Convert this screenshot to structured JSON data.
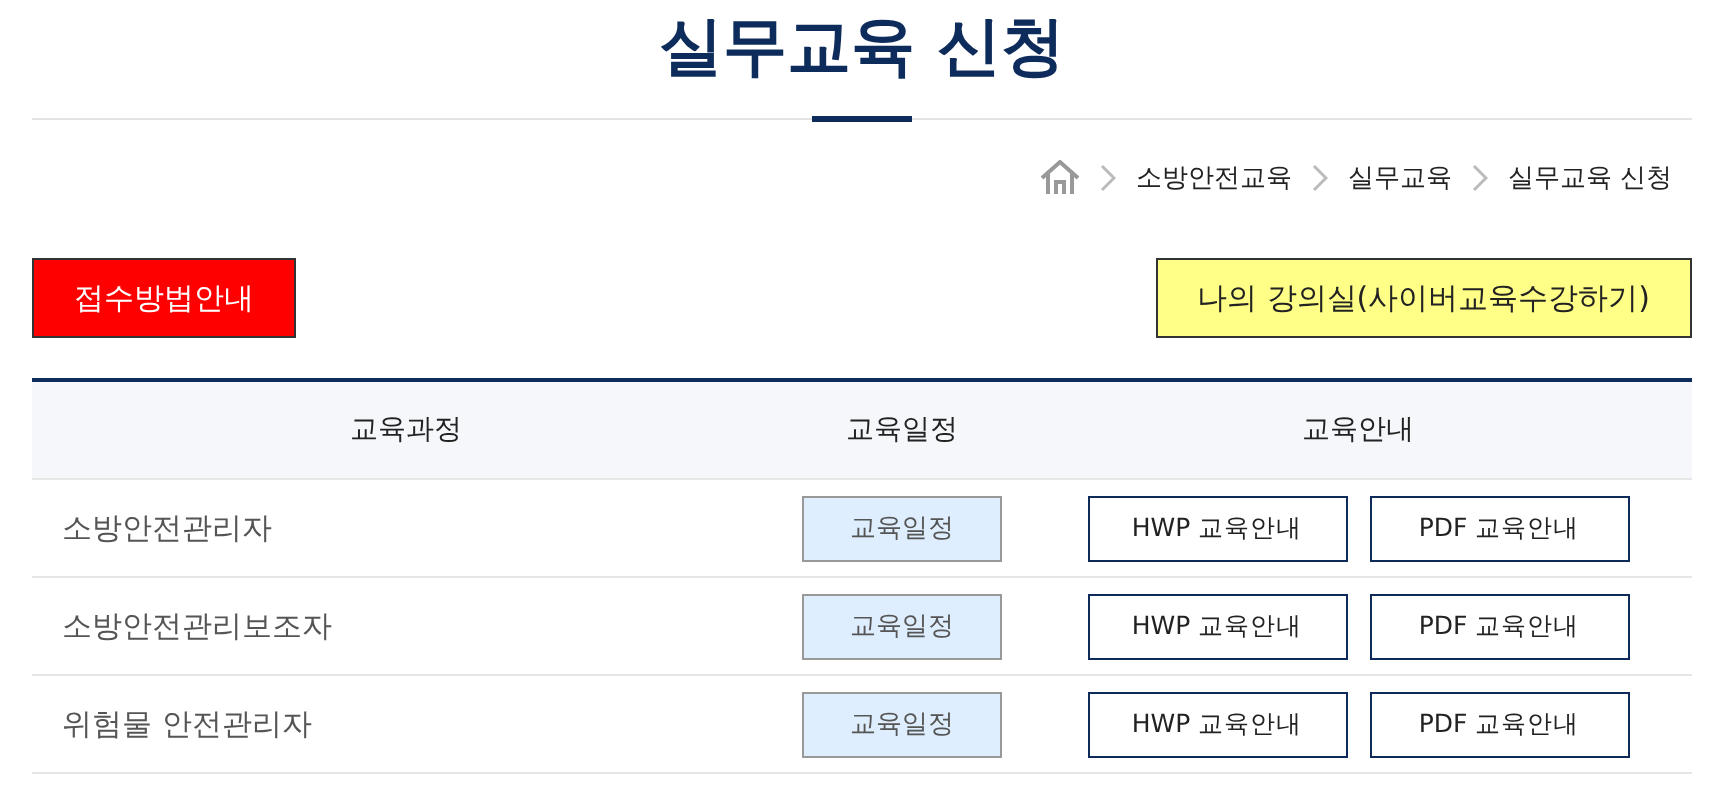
{
  "title": "실무교육 신청",
  "breadcrumb": [
    "소방안전교육",
    "실무교육",
    "실무교육 신청"
  ],
  "actions": [
    {
      "label": "접수방법안내",
      "kind": "red"
    },
    {
      "label": "나의 강의실(사이버교육수강하기)",
      "kind": "yellow"
    }
  ],
  "table": {
    "columns": [
      "교육과정",
      "교육일정",
      "교육안내"
    ],
    "rows": [
      {
        "course": "소방안전관리자",
        "schedule": "교육일정",
        "guides": [
          "HWP 교육안내",
          "PDF 교육안내"
        ]
      },
      {
        "course": "소방안전관리보조자",
        "schedule": "교육일정",
        "guides": [
          "HWP 교육안내",
          "PDF 교육안내"
        ]
      },
      {
        "course": "위험물 안전관리자",
        "schedule": "교육일정",
        "guides": [
          "HWP 교육안내",
          "PDF 교육안내"
        ]
      }
    ]
  }
}
